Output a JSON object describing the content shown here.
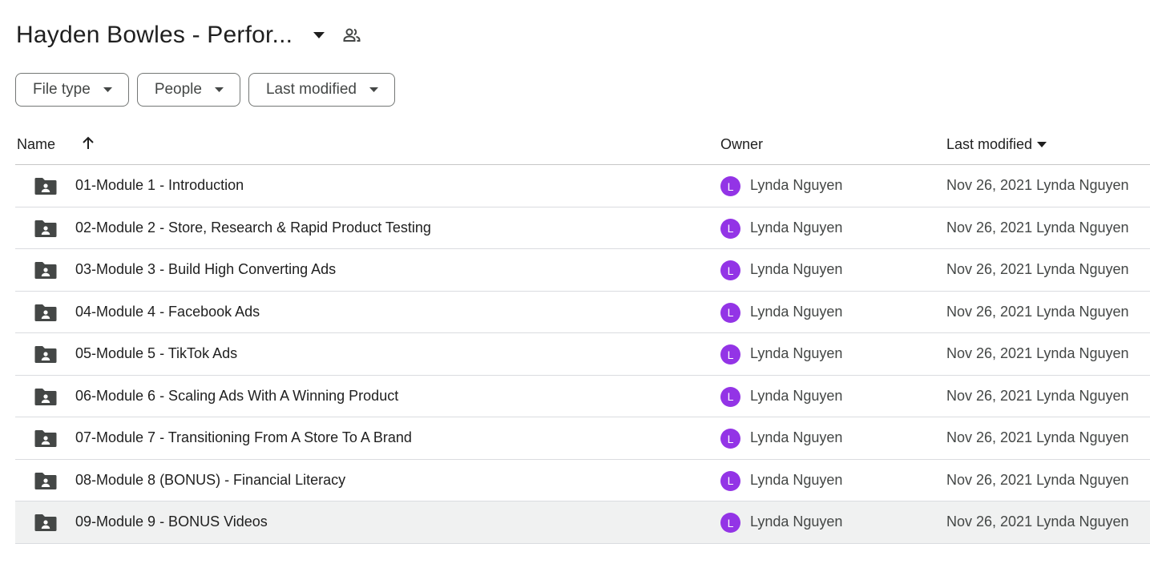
{
  "header": {
    "title": "Hayden Bowles - Perfor...",
    "caret_icon": "arrow-drop-down-icon",
    "shared_icon": "people-icon"
  },
  "filters": [
    {
      "label": "File type"
    },
    {
      "label": "People"
    },
    {
      "label": "Last modified"
    }
  ],
  "table": {
    "columns": {
      "name": "Name",
      "owner": "Owner",
      "modified": "Last modified"
    },
    "sort_icon": "arrow-upward-icon",
    "rows": [
      {
        "name": "01-Module 1 - Introduction",
        "owner_initial": "L",
        "owner": "Lynda Nguyen",
        "modified": "Nov 26, 2021 Lynda Nguyen"
      },
      {
        "name": "02-Module 2 - Store, Research & Rapid Product Testing",
        "owner_initial": "L",
        "owner": "Lynda Nguyen",
        "modified": "Nov 26, 2021 Lynda Nguyen"
      },
      {
        "name": "03-Module 3 - Build High Converting Ads",
        "owner_initial": "L",
        "owner": "Lynda Nguyen",
        "modified": "Nov 26, 2021 Lynda Nguyen"
      },
      {
        "name": "04-Module 4 - Facebook Ads",
        "owner_initial": "L",
        "owner": "Lynda Nguyen",
        "modified": "Nov 26, 2021 Lynda Nguyen"
      },
      {
        "name": "05-Module 5 - TikTok Ads",
        "owner_initial": "L",
        "owner": "Lynda Nguyen",
        "modified": "Nov 26, 2021 Lynda Nguyen"
      },
      {
        "name": "06-Module 6 - Scaling Ads With A Winning Product",
        "owner_initial": "L",
        "owner": "Lynda Nguyen",
        "modified": "Nov 26, 2021 Lynda Nguyen"
      },
      {
        "name": "07-Module 7 - Transitioning From A Store To A Brand",
        "owner_initial": "L",
        "owner": "Lynda Nguyen",
        "modified": "Nov 26, 2021 Lynda Nguyen"
      },
      {
        "name": "08-Module 8 (BONUS) - Financial Literacy",
        "owner_initial": "L",
        "owner": "Lynda Nguyen",
        "modified": "Nov 26, 2021 Lynda Nguyen"
      },
      {
        "name": "09-Module 9 - BONUS Videos",
        "owner_initial": "L",
        "owner": "Lynda Nguyen",
        "modified": "Nov 26, 2021 Lynda Nguyen"
      }
    ]
  },
  "colors": {
    "avatar": "#9334e6",
    "row_highlight": "#f0f1f1",
    "folder_icon": "#444746"
  }
}
